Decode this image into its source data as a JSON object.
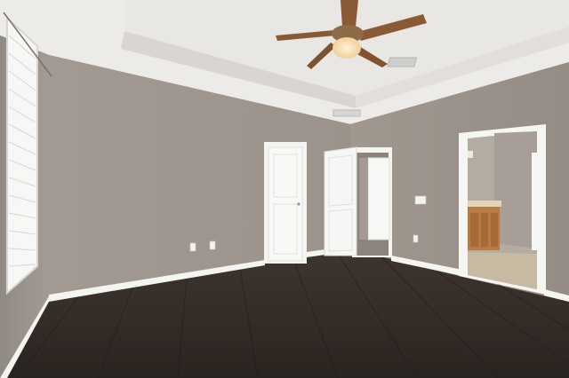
{
  "scene": {
    "type": "photograph",
    "subject": "empty-room-interior",
    "colors": {
      "wall": "#9c948c",
      "wall_light": "#aaa39b",
      "ceiling": "#ebebe9",
      "trim": "#f4f4f1",
      "floor_dark": "#2f2823",
      "floor_mid": "#3e3530",
      "cabinet": "#b97a45",
      "tile_floor": "#c8b9a2",
      "fan_wood": "#8a5a35",
      "fan_glow": "#f3d7a1"
    }
  }
}
